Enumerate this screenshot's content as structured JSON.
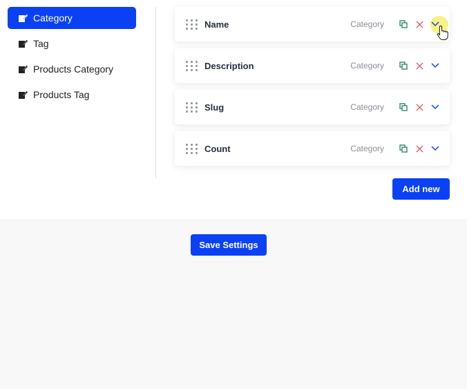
{
  "sidebar": {
    "items": [
      {
        "label": "Category",
        "active": true,
        "icon": "edit-icon"
      },
      {
        "label": "Tag",
        "active": false,
        "icon": "edit-icon"
      },
      {
        "label": "Products Category",
        "active": false,
        "icon": "edit-icon"
      },
      {
        "label": "Products Tag",
        "active": false,
        "icon": "edit-icon"
      }
    ]
  },
  "fields": [
    {
      "label": "Name",
      "tag": "Category"
    },
    {
      "label": "Description",
      "tag": "Category"
    },
    {
      "label": "Slug",
      "tag": "Category"
    },
    {
      "label": "Count",
      "tag": "Category"
    }
  ],
  "actions": {
    "add_new": "Add new",
    "save_settings": "Save Settings"
  },
  "colors": {
    "accent": "#0b41f5",
    "copy_icon": "#2f8a6b",
    "delete_icon": "#d9534f",
    "toggle_icon": "#0b41f5"
  }
}
